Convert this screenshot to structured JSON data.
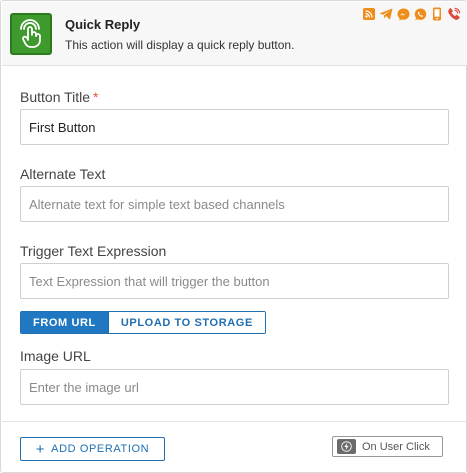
{
  "header": {
    "title": "Quick Reply",
    "description": "This action will display a quick reply button.",
    "action_icon": "touch-tap-icon",
    "channel_icons": [
      {
        "name": "rss-icon",
        "color": "#f08c1a"
      },
      {
        "name": "telegram-icon",
        "color": "#f08c1a"
      },
      {
        "name": "messenger-icon",
        "color": "#f08c1a"
      },
      {
        "name": "whatsapp-icon",
        "color": "#f08c1a"
      },
      {
        "name": "sms-phone-icon",
        "color": "#f08c1a"
      },
      {
        "name": "phone-call-icon",
        "color": "#e0493a"
      }
    ]
  },
  "fields": {
    "button_title": {
      "label": "Button Title",
      "required_mark": "*",
      "value": "First Button"
    },
    "alternate_text": {
      "label": "Alternate Text",
      "placeholder": "Alternate text for simple text based channels"
    },
    "trigger_expression": {
      "label": "Trigger Text Expression",
      "placeholder": "Text Expression that will trigger the button"
    },
    "image_url": {
      "label": "Image URL",
      "placeholder": "Enter the image url"
    }
  },
  "image_source_toggle": {
    "options": [
      "FROM URL",
      "UPLOAD TO STORAGE"
    ],
    "selected": "FROM URL"
  },
  "footer": {
    "add_operation_label": "ADD OPERATION",
    "trigger_label": "On User Click"
  },
  "colors": {
    "accent": "#1f78c1",
    "action_green": "#3f9a2e",
    "required": "#e8533a"
  }
}
